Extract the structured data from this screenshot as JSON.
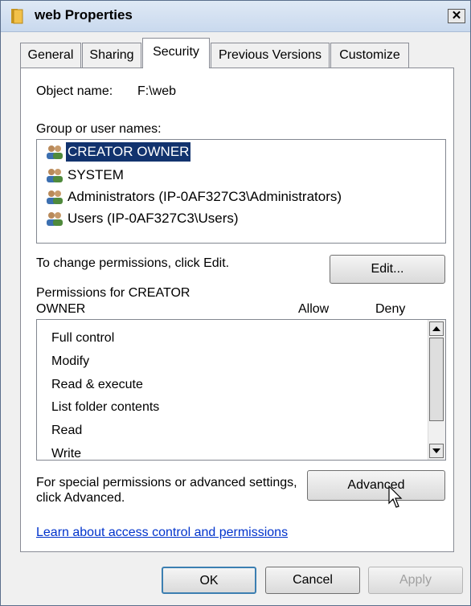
{
  "window": {
    "title": "web Properties",
    "close_symbol": "✕"
  },
  "tabs": [
    {
      "label": "General"
    },
    {
      "label": "Sharing"
    },
    {
      "label": "Security"
    },
    {
      "label": "Previous Versions"
    },
    {
      "label": "Customize"
    }
  ],
  "active_tab": "Security",
  "object_name": {
    "label": "Object name:",
    "value": "F:\\web"
  },
  "group_users": {
    "label": "Group or user names:",
    "items": [
      {
        "name": "CREATOR OWNER",
        "icon": "users-group-icon",
        "selected": true
      },
      {
        "name": "SYSTEM",
        "icon": "users-group-icon",
        "selected": false
      },
      {
        "name": "Administrators (IP-0AF327C3\\Administrators)",
        "icon": "users-group-icon",
        "selected": false
      },
      {
        "name": "Users (IP-0AF327C3\\Users)",
        "icon": "users-group-icon",
        "selected": false
      }
    ]
  },
  "change_permissions": {
    "text": "To change permissions, click Edit.",
    "edit_button": "Edit..."
  },
  "permissions": {
    "label_line1": "Permissions for CREATOR",
    "label_line2": "OWNER",
    "allow_header": "Allow",
    "deny_header": "Deny",
    "items": [
      "Full control",
      "Modify",
      "Read & execute",
      "List folder contents",
      "Read",
      "Write"
    ]
  },
  "advanced": {
    "text_line1": "For special permissions or advanced settings,",
    "text_line2": "click Advanced.",
    "button": "Advanced"
  },
  "help_link": "Learn about access control and permissions",
  "footer": {
    "ok": "OK",
    "cancel": "Cancel",
    "apply": "Apply"
  },
  "colors": {
    "selection": "#12336e",
    "link": "#0033cc",
    "disabled_text": "#a0a0a0"
  }
}
